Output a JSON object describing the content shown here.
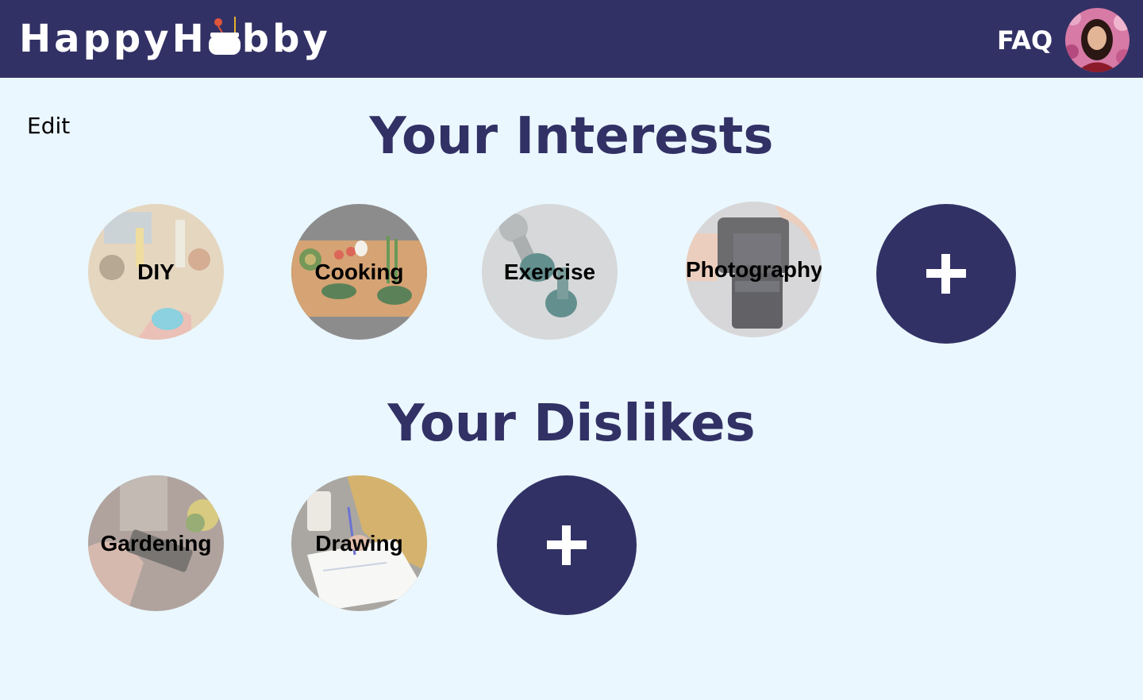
{
  "header": {
    "logo_left": "HappyH",
    "logo_right": "bby",
    "faq_label": "FAQ"
  },
  "page": {
    "edit_label": "Edit"
  },
  "interests": {
    "title": "Your Interests",
    "items": [
      {
        "label": "DIY",
        "icon": "diy-craft-photo"
      },
      {
        "label": "Cooking",
        "icon": "cooking-board-photo"
      },
      {
        "label": "Exercise",
        "icon": "dumbbell-photo"
      },
      {
        "label": "Photography",
        "icon": "camera-photo"
      }
    ],
    "add_icon": "plus-icon"
  },
  "dislikes": {
    "title": "Your Dislikes",
    "items": [
      {
        "label": "Gardening",
        "icon": "gardening-photo"
      },
      {
        "label": "Drawing",
        "icon": "drawing-photo"
      }
    ],
    "add_icon": "plus-icon"
  },
  "colors": {
    "brand": "#323165",
    "background": "#eaf7fe",
    "white": "#ffffff"
  }
}
